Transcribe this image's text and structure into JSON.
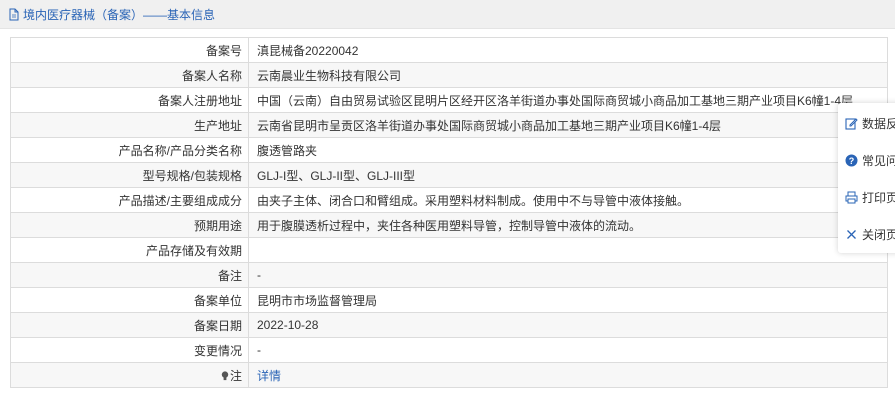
{
  "header": {
    "title": "境内医疗器械（备案）——基本信息"
  },
  "rows": [
    {
      "label": "备案号",
      "value": "滇昆械备20220042"
    },
    {
      "label": "备案人名称",
      "value": "云南晨业生物科技有限公司"
    },
    {
      "label": "备案人注册地址",
      "value": "中国（云南）自由贸易试验区昆明片区经开区洛羊街道办事处国际商贸城小商品加工基地三期产业项目K6幢1-4层"
    },
    {
      "label": "生产地址",
      "value": "云南省昆明市呈贡区洛羊街道办事处国际商贸城小商品加工基地三期产业项目K6幢1-4层"
    },
    {
      "label": "产品名称/产品分类名称",
      "value": "腹透管路夹"
    },
    {
      "label": "型号规格/包装规格",
      "value": "GLJ-I型、GLJ-II型、GLJ-III型"
    },
    {
      "label": "产品描述/主要组成成分",
      "value": "由夹子主体、闭合口和臂组成。采用塑料材料制成。使用中不与导管中液体接触。"
    },
    {
      "label": "预期用途",
      "value": "用于腹膜透析过程中，夹住各种医用塑料导管，控制导管中液体的流动。"
    },
    {
      "label": "产品存储及有效期",
      "value": ""
    },
    {
      "label": "备注",
      "value": "-"
    },
    {
      "label": "备案单位",
      "value": "昆明市市场监督管理局"
    },
    {
      "label": "备案日期",
      "value": "2022-10-28"
    },
    {
      "label": "变更情况",
      "value": "-"
    }
  ],
  "note_row": {
    "label": "注",
    "link_text": "详情"
  },
  "side_panel": {
    "feedback": "数据反",
    "faq": "常见问",
    "print": "打印页",
    "close": "关闭页"
  },
  "colors": {
    "link": "#2a64b6",
    "header_bg": "#f0f0f0",
    "border": "#dcdcdc"
  },
  "icons": [
    "document-icon",
    "bulb-icon",
    "edit-icon",
    "question-icon",
    "printer-icon",
    "close-icon"
  ]
}
